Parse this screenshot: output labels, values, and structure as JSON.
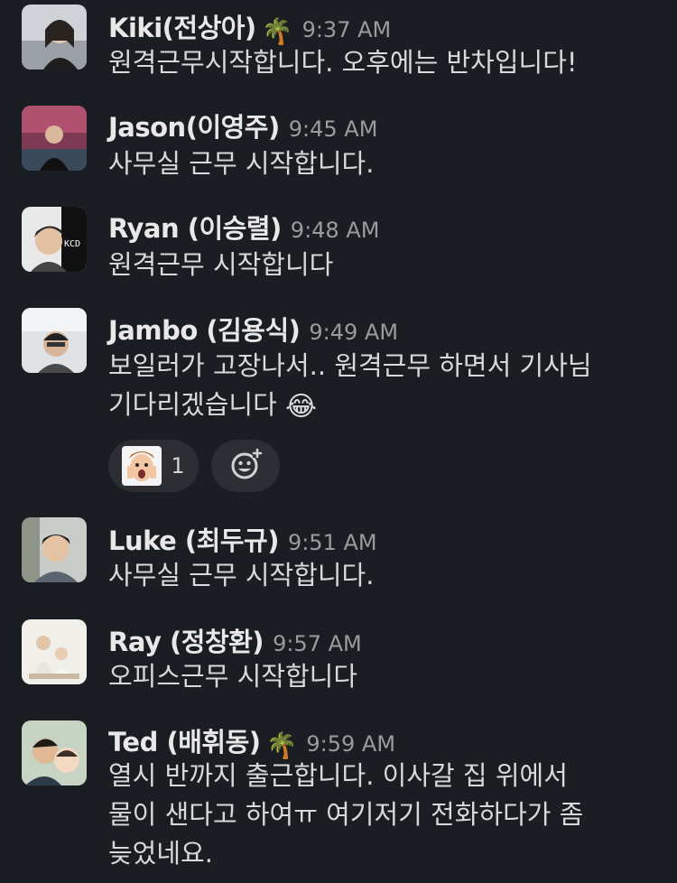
{
  "messages": [
    {
      "name": "Kiki(전상아)",
      "status": "🌴",
      "time": "9:37 AM",
      "text": "원격근무시작합니다. 오후에는 반차입니다!"
    },
    {
      "name": "Jason(이영주)",
      "time": "9:45 AM",
      "text": "사무실 근무 시작합니다."
    },
    {
      "name": "Ryan (이승렬)",
      "time": "9:48 AM",
      "text": "원격근무 시작합니다",
      "avatar_text": "KCD"
    },
    {
      "name": "Jambo (김용식)",
      "time": "9:49 AM",
      "text": "보일러가 고장나서.. 원격근무 하면서 기사님\n기다리겠습니다",
      "emoji": "😂",
      "reaction_count": "1"
    },
    {
      "name": "Luke (최두규)",
      "time": "9:51 AM",
      "text": "사무실 근무 시작합니다."
    },
    {
      "name": "Ray (정창환)",
      "time": "9:57 AM",
      "text": "오피스근무 시작합니다"
    },
    {
      "name": "Ted (배휘동)",
      "status": "🌴",
      "time": "9:59 AM",
      "text": "열시 반까지 출근합니다. 이사갈 집 위에서\n물이 샌다고 하여ㅠ 여기저기 전화하다가 좀\n늦었네요."
    }
  ],
  "icons": {
    "add_reaction": "add-reaction-icon",
    "status": "palm-tree-icon"
  },
  "colors": {
    "background": "#1a1d21",
    "pill": "#2c2e33",
    "text": "#d8d9da",
    "time": "#9a9b9e"
  }
}
